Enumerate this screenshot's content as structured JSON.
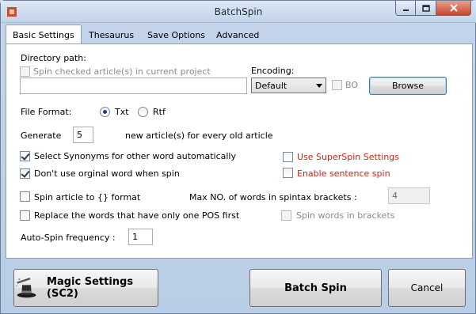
{
  "window": {
    "title": "BatchSpin"
  },
  "tabs": [
    {
      "label": "Basic Settings",
      "active": true
    },
    {
      "label": "Thesaurus"
    },
    {
      "label": "Save Options"
    },
    {
      "label": "Advanced"
    }
  ],
  "directory": {
    "label": "Directory path:",
    "spin_checked_label": "Spin checked article(s) in current project",
    "spin_checked": false,
    "path_value": ""
  },
  "encoding": {
    "label": "Encoding:",
    "selected": "Default",
    "bo_label": "BO",
    "bo_checked": false,
    "browse_label": "Browse"
  },
  "file_format": {
    "label": "File Format:",
    "options": [
      {
        "label": "Txt",
        "selected": true
      },
      {
        "label": "Rtf",
        "selected": false
      }
    ]
  },
  "generate": {
    "label": "Generate",
    "value": "5",
    "suffix": "new article(s) for every old article"
  },
  "options": {
    "select_synonyms": {
      "label": "Select Synonyms for other word automatically",
      "checked": true
    },
    "dont_use_original": {
      "label": "Don't use orginal word when spin",
      "checked": true
    },
    "spin_to_format": {
      "label": "Spin article to {} format",
      "checked": false
    },
    "replace_one_pos": {
      "label": "Replace the words that have only one POS first",
      "checked": false
    },
    "use_superspin": {
      "label": "Use SuperSpin Settings",
      "checked": false
    },
    "enable_sentence_spin": {
      "label": "Enable sentence spin",
      "checked": false
    },
    "spin_words_brackets": {
      "label": "Spin words in brackets",
      "checked": false
    }
  },
  "max_words": {
    "label": "Max NO. of words in spintax brackets :",
    "value": "4"
  },
  "auto_spin": {
    "label": "Auto-Spin frequency :",
    "value": "1"
  },
  "buttons": {
    "magic_settings": "Magic Settings (SC2)",
    "batch_spin": "Batch Spin",
    "cancel": "Cancel"
  },
  "colors": {
    "accent_red": "#c8261b",
    "focus_blue": "#3c7fb1"
  }
}
